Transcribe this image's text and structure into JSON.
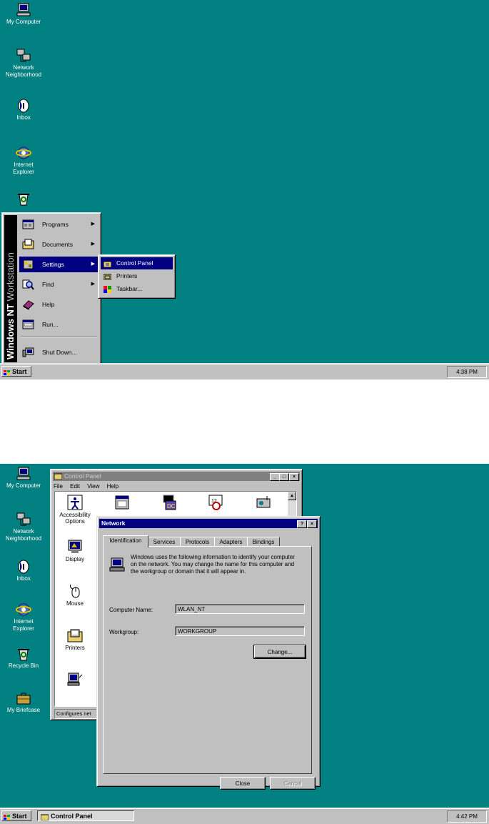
{
  "screen1": {
    "desktop_icons": [
      {
        "label": "My Computer",
        "icon": "computer-icon"
      },
      {
        "label": "Network\nNeighborhood",
        "icon": "network-icon"
      },
      {
        "label": "Inbox",
        "icon": "inbox-icon"
      },
      {
        "label": "Internet\nExplorer",
        "icon": "ie-icon"
      },
      {
        "label": "",
        "icon": "recycle-bin-icon"
      }
    ],
    "start_menu": {
      "sidebar_bold": "Windows NT",
      "sidebar_light": "Workstation",
      "items": [
        {
          "label": "Programs",
          "icon": "programs-icon",
          "submenu": true
        },
        {
          "label": "Documents",
          "icon": "documents-icon",
          "submenu": true
        },
        {
          "label": "Settings",
          "icon": "settings-icon",
          "submenu": true,
          "highlighted": true
        },
        {
          "label": "Find",
          "icon": "find-icon",
          "submenu": true
        },
        {
          "label": "Help",
          "icon": "help-icon",
          "submenu": false
        },
        {
          "label": "Run...",
          "icon": "run-icon",
          "submenu": false
        },
        {
          "label": "Shut Down...",
          "icon": "shutdown-icon",
          "submenu": false
        }
      ]
    },
    "settings_submenu": [
      {
        "label": "Control Panel",
        "icon": "control-panel-icon",
        "highlighted": true
      },
      {
        "label": "Printers",
        "icon": "printers-icon"
      },
      {
        "label": "Taskbar...",
        "icon": "taskbar-icon"
      }
    ],
    "taskbar": {
      "start_label": "Start",
      "clock": "4:38 PM"
    }
  },
  "screen2": {
    "desktop_icons": [
      {
        "label": "My Computer",
        "icon": "computer-icon"
      },
      {
        "label": "Network\nNeighborhood",
        "icon": "network-icon"
      },
      {
        "label": "Inbox",
        "icon": "inbox-icon"
      },
      {
        "label": "Internet\nExplorer",
        "icon": "ie-icon"
      },
      {
        "label": "Recycle Bin",
        "icon": "recycle-bin-icon"
      },
      {
        "label": "My Briefcase",
        "icon": "briefcase-icon"
      }
    ],
    "control_panel": {
      "title": "Control Panel",
      "menu": [
        "File",
        "Edit",
        "View",
        "Help"
      ],
      "icons": [
        {
          "label": "Accessibility\nOptions",
          "icon": "accessibility-icon"
        },
        {
          "label": "",
          "icon": "add-remove-programs-icon"
        },
        {
          "label": "",
          "icon": "console-icon"
        },
        {
          "label": "",
          "icon": "date-time-icon"
        },
        {
          "label": "",
          "icon": "devices-icon"
        },
        {
          "label": "Display",
          "icon": "display-icon"
        },
        {
          "label": "Mouse",
          "icon": "mouse-icon"
        },
        {
          "label": "Printers",
          "icon": "printers-icon"
        },
        {
          "label": "",
          "icon": "network-icon"
        }
      ],
      "status": "Configures net"
    },
    "network_dialog": {
      "title": "Network",
      "tabs": [
        "Identification",
        "Services",
        "Protocols",
        "Adapters",
        "Bindings"
      ],
      "selected_tab": 0,
      "description": "Windows uses the following information to identify your computer on the network. You may change the name for this computer and the workgroup or domain that it will appear in.",
      "computer_name_label": "Computer Name:",
      "computer_name_value": "WLAN_NT",
      "workgroup_label": "Workgroup:",
      "workgroup_value": "WORKGROUP",
      "change_button": "Change...",
      "close_button": "Close",
      "cancel_button": "Cancel"
    },
    "taskbar": {
      "start_label": "Start",
      "task_label": "Control Panel",
      "clock": "4:42 PM"
    }
  }
}
